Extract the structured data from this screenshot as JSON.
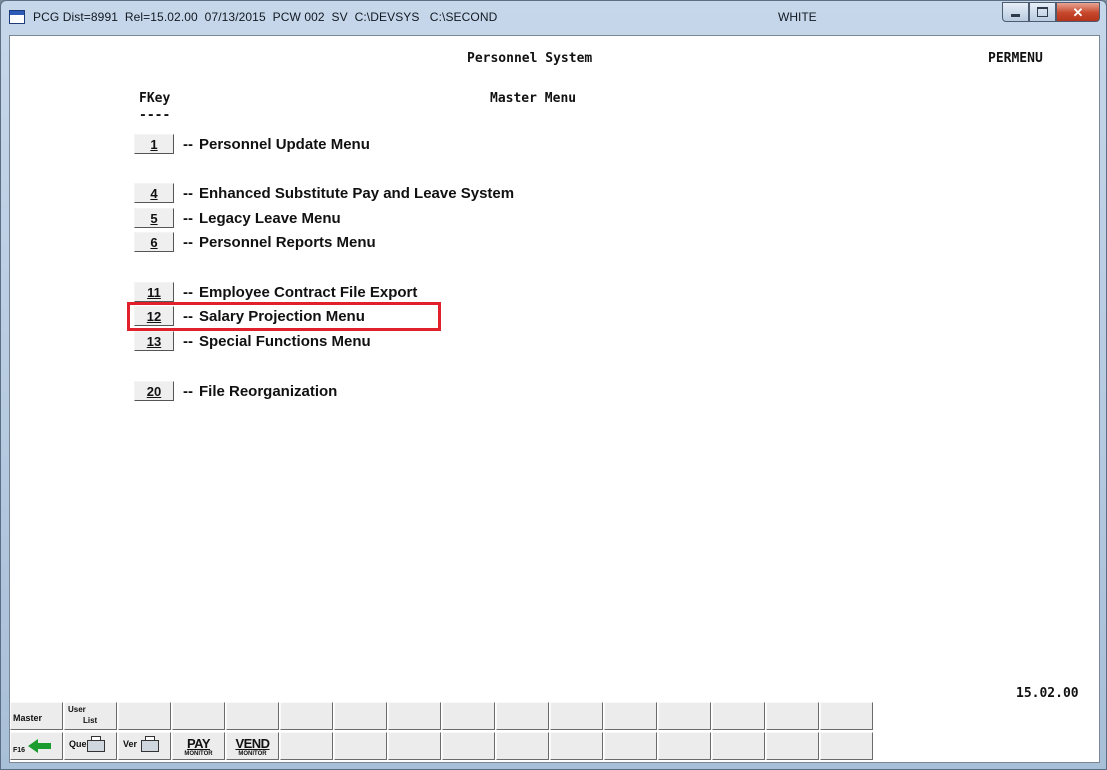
{
  "window": {
    "title": "PCG Dist=8991  Rel=15.02.00  07/13/2015  PCW 002  SV  C:\\DEVSYS   C:\\SECOND",
    "environment": "WHITE",
    "controls": [
      "minimize",
      "maximize",
      "close"
    ]
  },
  "screen": {
    "system_title": "Personnel System",
    "screen_id": "PERMENU",
    "fkey_header": "FKey",
    "fkey_rule": "----",
    "menu_title": "Master Menu",
    "version": "15.02.00"
  },
  "menu_items": [
    {
      "key": "1",
      "sep": "--",
      "label": "Personnel Update Menu"
    },
    {
      "key": "4",
      "sep": "--",
      "label": "Enhanced Substitute Pay and Leave System"
    },
    {
      "key": "5",
      "sep": "--",
      "label": "Legacy Leave Menu"
    },
    {
      "key": "6",
      "sep": "--",
      "label": "Personnel Reports Menu"
    },
    {
      "key": "11",
      "sep": "--",
      "label": "Employee Contract File Export"
    },
    {
      "key": "12",
      "sep": "--",
      "label": "Salary Projection Menu",
      "highlighted": true
    },
    {
      "key": "13",
      "sep": "--",
      "label": "Special Functions Menu"
    },
    {
      "key": "20",
      "sep": "--",
      "label": "File Reorganization"
    }
  ],
  "highlight_color": "#e0202a",
  "toolbar": {
    "master": "Master",
    "user_list_a": "User",
    "user_list_b": "List",
    "f16": "F16",
    "print_a": "Que",
    "print_b": "Ver",
    "pay": "PAY",
    "pay_sub": "MONITOR",
    "vend": "VEND",
    "vend_sub": "MONITOR",
    "back_icon": "green-left-arrow-icon",
    "printer_icon": "printer-icon"
  }
}
